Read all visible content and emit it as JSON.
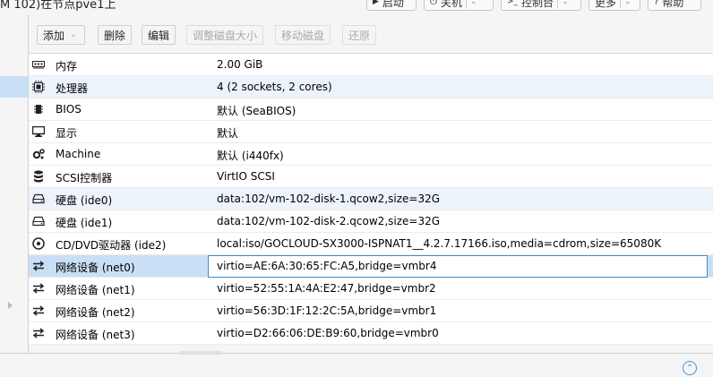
{
  "header": {
    "title": "M 102)在节点pve1上",
    "buttons": {
      "start": "启动",
      "shutdown": "关机",
      "console": "控制台",
      "more": "更多",
      "help": "帮助"
    }
  },
  "toolbar": {
    "add": "添加",
    "remove": "删除",
    "edit": "编辑",
    "resize": "调整磁盘大小",
    "move": "移动磁盘",
    "revert": "还原"
  },
  "hardware": [
    {
      "icon": "memory-icon",
      "name": "内存",
      "value": "2.00 GiB"
    },
    {
      "icon": "cpu-icon",
      "name": "处理器",
      "value": "4 (2 sockets, 2 cores)"
    },
    {
      "icon": "bios-icon",
      "name": "BIOS",
      "value": "默认 (SeaBIOS)"
    },
    {
      "icon": "display-icon",
      "name": "显示",
      "value": "默认"
    },
    {
      "icon": "machine-icon",
      "name": "Machine",
      "value": "默认 (i440fx)"
    },
    {
      "icon": "database-icon",
      "name": "SCSI控制器",
      "value": "VirtIO SCSI"
    },
    {
      "icon": "harddisk-icon",
      "name": "硬盘 (ide0)",
      "value": "data:102/vm-102-disk-1.qcow2,size=32G"
    },
    {
      "icon": "harddisk-icon",
      "name": "硬盘 (ide1)",
      "value": "data:102/vm-102-disk-2.qcow2,size=32G"
    },
    {
      "icon": "cdrom-icon",
      "name": "CD/DVD驱动器 (ide2)",
      "value": "local:iso/GOCLOUD-SX3000-ISPNAT1__4.2.7.17166.iso,media=cdrom,size=65080K"
    },
    {
      "icon": "network-icon",
      "name": "网络设备 (net0)",
      "value": "virtio=AE:6A:30:65:FC:A5,bridge=vmbr4"
    },
    {
      "icon": "network-icon",
      "name": "网络设备 (net1)",
      "value": "virtio=52:55:1A:4A:E2:47,bridge=vmbr2"
    },
    {
      "icon": "network-icon",
      "name": "网络设备 (net2)",
      "value": "virtio=56:3D:1F:12:2C:5A,bridge=vmbr1"
    },
    {
      "icon": "network-icon",
      "name": "网络设备 (net3)",
      "value": "virtio=D2:66:06:DE:B9:60,bridge=vmbr0"
    }
  ],
  "selected_row": 9,
  "colors": {
    "selection": "#c9dff5",
    "alt_row": "#edf3fb",
    "focus_border": "#3e8ed0"
  }
}
